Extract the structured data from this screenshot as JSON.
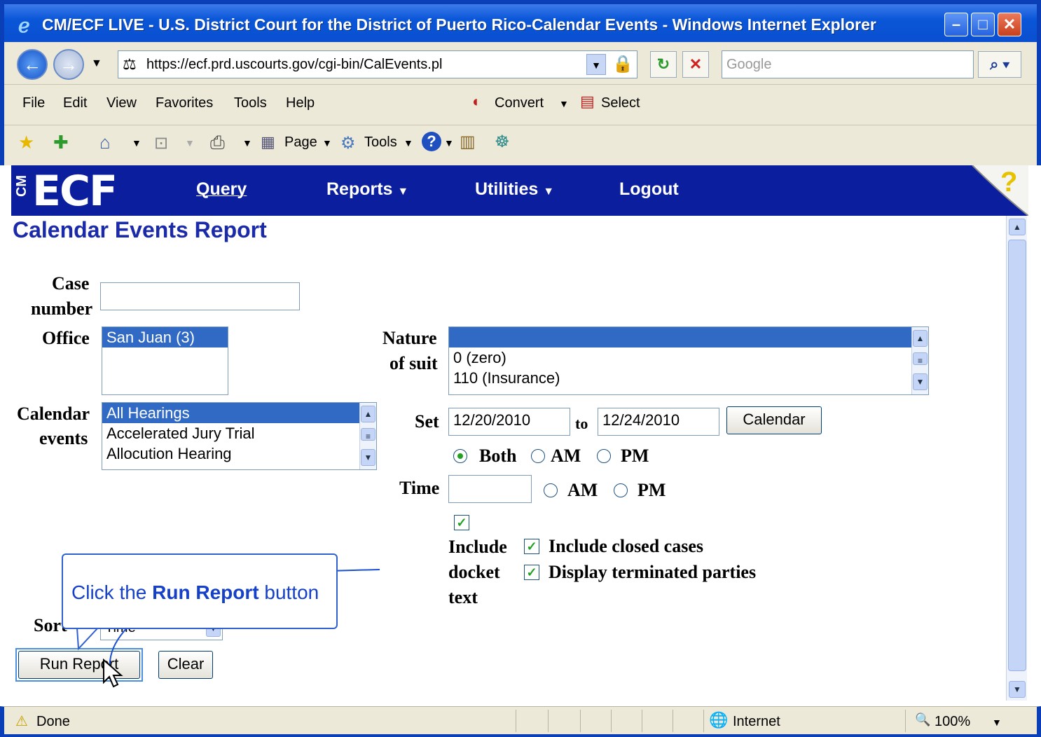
{
  "window": {
    "title": "CM/ECF LIVE - U.S. District Court for the District of Puerto Rico-Calendar Events - Windows Internet Explorer"
  },
  "address_bar": {
    "url": "https://ecf.prd.uscourts.gov/cgi-bin/CalEvents.pl",
    "search_placeholder": "Google"
  },
  "menu": [
    "File",
    "Edit",
    "View",
    "Favorites",
    "Tools",
    "Help"
  ],
  "toolbar": {
    "convert": "Convert",
    "select": "Select",
    "page": "Page",
    "tools": "Tools"
  },
  "ecf_nav": {
    "logo": "ECF",
    "logo_prefix": "CM",
    "query": "Query",
    "reports": "Reports",
    "utilities": "Utilities",
    "logout": "Logout",
    "help_icon": "?"
  },
  "page": {
    "title": "Calendar Events Report",
    "case_number_label_1": "Case",
    "case_number_label_2": "number",
    "office_label": "Office",
    "office_options": [
      "San Juan (3)"
    ],
    "nature_label_1": "Nature",
    "nature_label_2": "of suit",
    "nature_options": [
      "",
      "0 (zero)",
      "110 (Insurance)"
    ],
    "calendar_label_1": "Calendar",
    "calendar_label_2": "events",
    "calendar_options": [
      "All Hearings",
      "Accelerated Jury Trial",
      "Allocution Hearing"
    ],
    "set_label": "Set",
    "set_from": "12/20/2010",
    "to_label": "to",
    "set_to": "12/24/2010",
    "calendar_button": "Calendar",
    "both_label": "Both",
    "am_label": "AM",
    "pm_label": "PM",
    "time_label": "Time",
    "include_docket_1": "Include",
    "include_docket_2": "docket",
    "include_docket_3": "text",
    "include_closed": "Include closed cases",
    "display_terminated": "Display terminated parties",
    "sort_label": "Sort",
    "sort_value": "Time",
    "run_report": "Run Report",
    "clear": "Clear"
  },
  "callout": {
    "prefix": "Click the ",
    "bold": "Run Report",
    "suffix": " button"
  },
  "status": {
    "text": "Done",
    "zone": "Internet",
    "zoom": "100%"
  }
}
